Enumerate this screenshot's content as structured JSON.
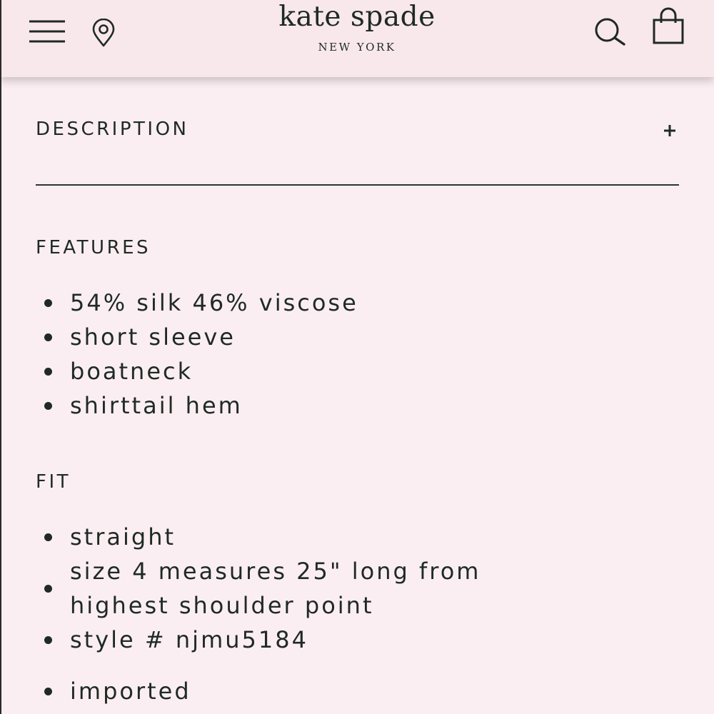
{
  "brand": {
    "name": "kate spade",
    "tagline": "NEW YORK"
  },
  "header": {
    "icons": [
      "menu-icon",
      "location-pin-icon",
      "search-icon",
      "shopping-bag-icon"
    ]
  },
  "description": {
    "title": "DESCRIPTION",
    "toggle_symbol": "+",
    "expanded": false
  },
  "features": {
    "heading": "FEATURES",
    "items": [
      "54% silk 46% viscose",
      "short sleeve",
      "boatneck",
      "shirttail hem"
    ]
  },
  "fit": {
    "heading": "FIT",
    "items": [
      "straight",
      "size 4 measures 25\" long from highest shoulder point",
      "style # njmu5184",
      "imported"
    ]
  },
  "colors": {
    "background": "#fbeef2",
    "header_background": "#f8e8ec",
    "text": "#1f2a24"
  }
}
